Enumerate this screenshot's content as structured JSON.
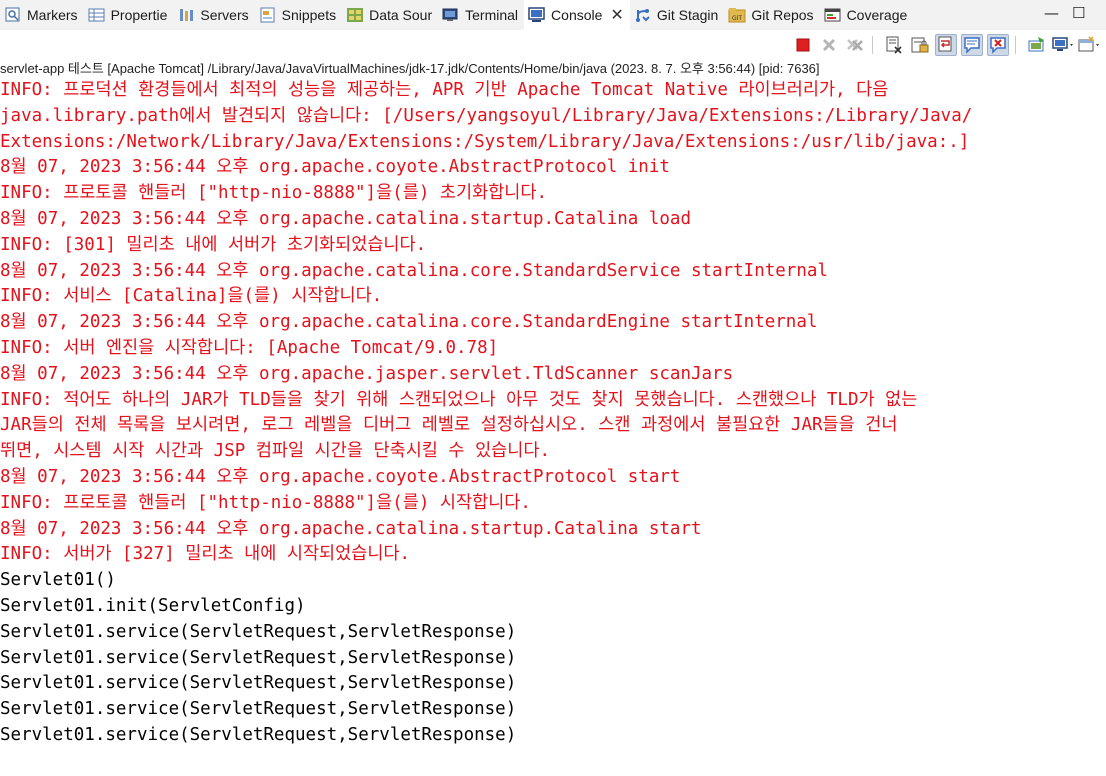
{
  "tabs": [
    {
      "label": "Markers",
      "icon": "markers-icon",
      "active": false
    },
    {
      "label": "Propertie",
      "icon": "properties-icon",
      "active": false
    },
    {
      "label": "Servers",
      "icon": "servers-icon",
      "active": false
    },
    {
      "label": "Snippets",
      "icon": "snippets-icon",
      "active": false
    },
    {
      "label": "Data Sour",
      "icon": "data-source-icon",
      "active": false
    },
    {
      "label": "Terminal",
      "icon": "terminal-icon",
      "active": false
    },
    {
      "label": "Console",
      "icon": "console-icon",
      "active": true
    },
    {
      "label": "Git Stagin",
      "icon": "git-staging-icon",
      "active": false
    },
    {
      "label": "Git Repos",
      "icon": "git-repos-icon",
      "active": false
    },
    {
      "label": "Coverage",
      "icon": "coverage-icon",
      "active": false
    }
  ],
  "window_controls": {
    "minimize": "—",
    "maximize": "☐"
  },
  "toolbar": {
    "buttons": [
      "terminate-icon",
      "remove-launch-icon",
      "remove-all-terminated-icon",
      "clear-console-icon",
      "scroll-lock-icon",
      "word-wrap-icon",
      "show-on-stdout-icon",
      "show-on-stderr-icon",
      "pin-console-icon",
      "display-selected-console-icon",
      "open-console-icon"
    ]
  },
  "process_label": "servlet-app 테스트 [Apache Tomcat] /Library/Java/JavaVirtualMachines/jdk-17.jdk/Contents/Home/bin/java  (2023. 8. 7. 오후 3:56:44) [pid: 7636]",
  "colors": {
    "stderr": "#e4121b",
    "stdout": "#000000",
    "terminate": "#e02020"
  },
  "console_lines": [
    {
      "text": "INFO: 프로덕션 환경들에서 최적의 성능을 제공하는, APR 기반 Apache Tomcat Native 라이브러리가, 다음",
      "stream": "err"
    },
    {
      "text": "java.library.path에서 발견되지 않습니다: [/Users/yangsoyul/Library/Java/Extensions:/Library/Java/",
      "stream": "err"
    },
    {
      "text": "Extensions:/Network/Library/Java/Extensions:/System/Library/Java/Extensions:/usr/lib/java:.]",
      "stream": "err"
    },
    {
      "text": "8월 07, 2023 3:56:44 오후 org.apache.coyote.AbstractProtocol init",
      "stream": "err"
    },
    {
      "text": "INFO: 프로토콜 핸들러 [\"http-nio-8888\"]을(를) 초기화합니다.",
      "stream": "err"
    },
    {
      "text": "8월 07, 2023 3:56:44 오후 org.apache.catalina.startup.Catalina load",
      "stream": "err"
    },
    {
      "text": "INFO: [301] 밀리초 내에 서버가 초기화되었습니다.",
      "stream": "err"
    },
    {
      "text": "8월 07, 2023 3:56:44 오후 org.apache.catalina.core.StandardService startInternal",
      "stream": "err"
    },
    {
      "text": "INFO: 서비스 [Catalina]을(를) 시작합니다.",
      "stream": "err"
    },
    {
      "text": "8월 07, 2023 3:56:44 오후 org.apache.catalina.core.StandardEngine startInternal",
      "stream": "err"
    },
    {
      "text": "INFO: 서버 엔진을 시작합니다: [Apache Tomcat/9.0.78]",
      "stream": "err"
    },
    {
      "text": "8월 07, 2023 3:56:44 오후 org.apache.jasper.servlet.TldScanner scanJars",
      "stream": "err"
    },
    {
      "text": "INFO: 적어도 하나의 JAR가 TLD들을 찾기 위해 스캔되었으나 아무 것도 찾지 못했습니다. 스캔했으나 TLD가 없는",
      "stream": "err"
    },
    {
      "text": "JAR들의 전체 목록을 보시려면, 로그 레벨을 디버그 레벨로 설정하십시오. 스캔 과정에서 불필요한 JAR들을 건너",
      "stream": "err"
    },
    {
      "text": "뛰면, 시스템 시작 시간과 JSP 컴파일 시간을 단축시킬 수 있습니다.",
      "stream": "err"
    },
    {
      "text": "8월 07, 2023 3:56:44 오후 org.apache.coyote.AbstractProtocol start",
      "stream": "err"
    },
    {
      "text": "INFO: 프로토콜 핸들러 [\"http-nio-8888\"]을(를) 시작합니다.",
      "stream": "err"
    },
    {
      "text": "8월 07, 2023 3:56:44 오후 org.apache.catalina.startup.Catalina start",
      "stream": "err"
    },
    {
      "text": "INFO: 서버가 [327] 밀리초 내에 시작되었습니다.",
      "stream": "err"
    },
    {
      "text": "Servlet01()",
      "stream": "out"
    },
    {
      "text": "Servlet01.init(ServletConfig)",
      "stream": "out"
    },
    {
      "text": "Servlet01.service(ServletRequest,ServletResponse)",
      "stream": "out"
    },
    {
      "text": "Servlet01.service(ServletRequest,ServletResponse)",
      "stream": "out"
    },
    {
      "text": "Servlet01.service(ServletRequest,ServletResponse)",
      "stream": "out"
    },
    {
      "text": "Servlet01.service(ServletRequest,ServletResponse)",
      "stream": "out"
    },
    {
      "text": "Servlet01.service(ServletRequest,ServletResponse)",
      "stream": "out"
    }
  ]
}
